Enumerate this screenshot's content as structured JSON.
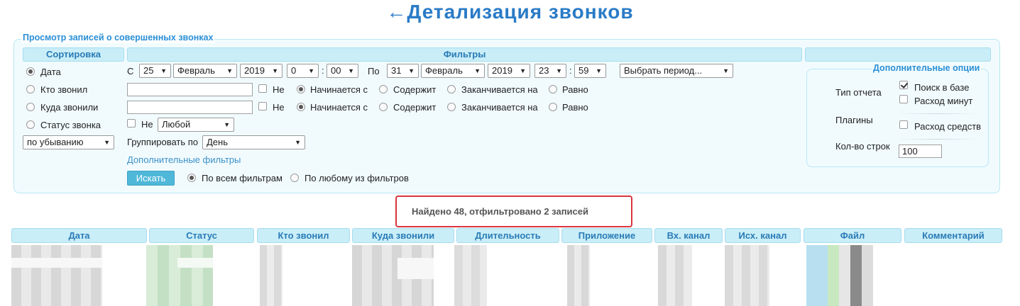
{
  "page": {
    "back_arrow": "←",
    "title": "Детализация звонков"
  },
  "filter_panel": {
    "legend": "Просмотр записей о совершенных звонках",
    "headers": {
      "sort": "Сортировка",
      "filters": "Фильтры",
      "extra": ""
    }
  },
  "sort": {
    "options": [
      {
        "label": "Дата",
        "selected": true
      },
      {
        "label": "Кто звонил",
        "selected": false
      },
      {
        "label": "Куда звонили",
        "selected": false
      },
      {
        "label": "Статус звонка",
        "selected": false
      }
    ],
    "order": "по убыванию"
  },
  "date_range": {
    "from_label": "С",
    "from": {
      "day": "25",
      "month": "Февраль",
      "year": "2019",
      "hour": "0",
      "minute": "00"
    },
    "to_label": "По",
    "to": {
      "day": "31",
      "month": "Февраль",
      "year": "2019",
      "hour": "23",
      "minute": "59"
    },
    "time_sep": ":",
    "period_placeholder": "Выбрать период..."
  },
  "caller_filter": {
    "value": "",
    "not_label": "Не",
    "not_checked": false,
    "modes": [
      "Начинается с",
      "Содержит",
      "Заканчивается на",
      "Равно"
    ],
    "selected_mode": 0
  },
  "callee_filter": {
    "value": "",
    "not_label": "Не",
    "not_checked": false,
    "modes": [
      "Начинается с",
      "Содержит",
      "Заканчивается на",
      "Равно"
    ],
    "selected_mode": 0
  },
  "status_filter": {
    "not_label": "Не",
    "not_checked": false,
    "value": "Любой"
  },
  "grouping": {
    "label": "Группировать по",
    "value": "День"
  },
  "additional_filters_link": "Дополнительные фильтры",
  "search_button": "Искать",
  "match_mode": {
    "options": [
      "По всем фильтрам",
      "По любому из фильтров"
    ],
    "selected": 0
  },
  "extra_options": {
    "legend": "Дополнительные опции",
    "report_type_label": "Тип отчета",
    "report_types": [
      {
        "label": "Поиск в базе",
        "checked": true
      },
      {
        "label": "Расход минут",
        "checked": false
      }
    ],
    "plugins_label": "Плагины",
    "plugins": [
      {
        "label": "Расход средств",
        "checked": false
      }
    ],
    "rows_label": "Кол-во строк",
    "rows_value": "100"
  },
  "result_message": "Найдено 48, отфильтровано 2 записей",
  "table": {
    "columns": [
      "Дата",
      "Статус",
      "Кто звонил",
      "Куда звонили",
      "Длительность",
      "Приложение",
      "Вх. канал",
      "Исх. канал",
      "Файл",
      "Комментарий"
    ]
  },
  "colors": {
    "accent": "#2a7bc6",
    "header_bg": "#c9eef8",
    "highlight_border": "#d9363e",
    "button": "#4fb8d9"
  }
}
